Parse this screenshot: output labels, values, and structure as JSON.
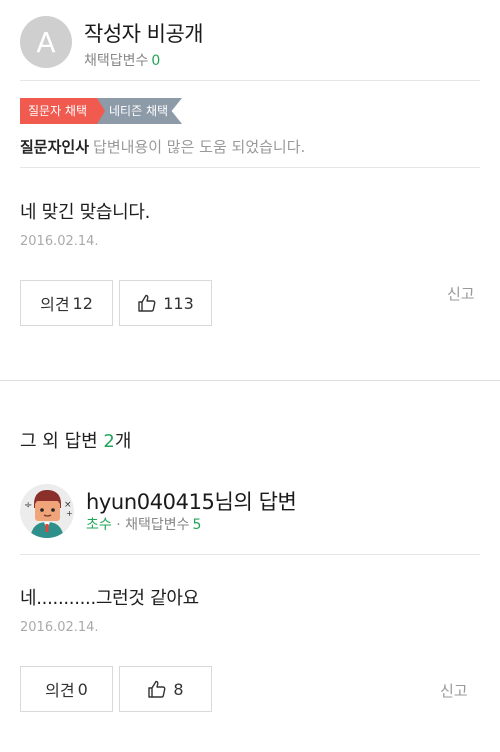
{
  "answer1": {
    "avatar_letter": "A",
    "author": "작성자 비공개",
    "selected_label": "채택답변수",
    "selected_count": "0",
    "badge_asker": "질문자 채택",
    "badge_netizen": "네티즌 채택",
    "thanks_label": "질문자인사",
    "thanks_message": "답변내용이 많은 도움 되었습니다.",
    "body": "네 맞긴 맞습니다.",
    "date": "2016.02.14.",
    "opinion_label": "의견",
    "opinion_count": "12",
    "like_count": "113",
    "report_label": "신고"
  },
  "other": {
    "title_prefix": "그 외 답변",
    "count": "2",
    "suffix": "개"
  },
  "answer2": {
    "author": "hyun040415님의 답변",
    "rank": "초수",
    "separator": "·",
    "selected_label": "채택답변수",
    "selected_count": "5",
    "body": "네...........그런것 같아요",
    "date": "2016.02.14.",
    "opinion_label": "의견",
    "opinion_count": "0",
    "like_count": "8",
    "report_label": "신고"
  },
  "colors": {
    "accent_green": "#22a559",
    "badge_red": "#f05a4f",
    "badge_grey": "#8d9aa8"
  }
}
